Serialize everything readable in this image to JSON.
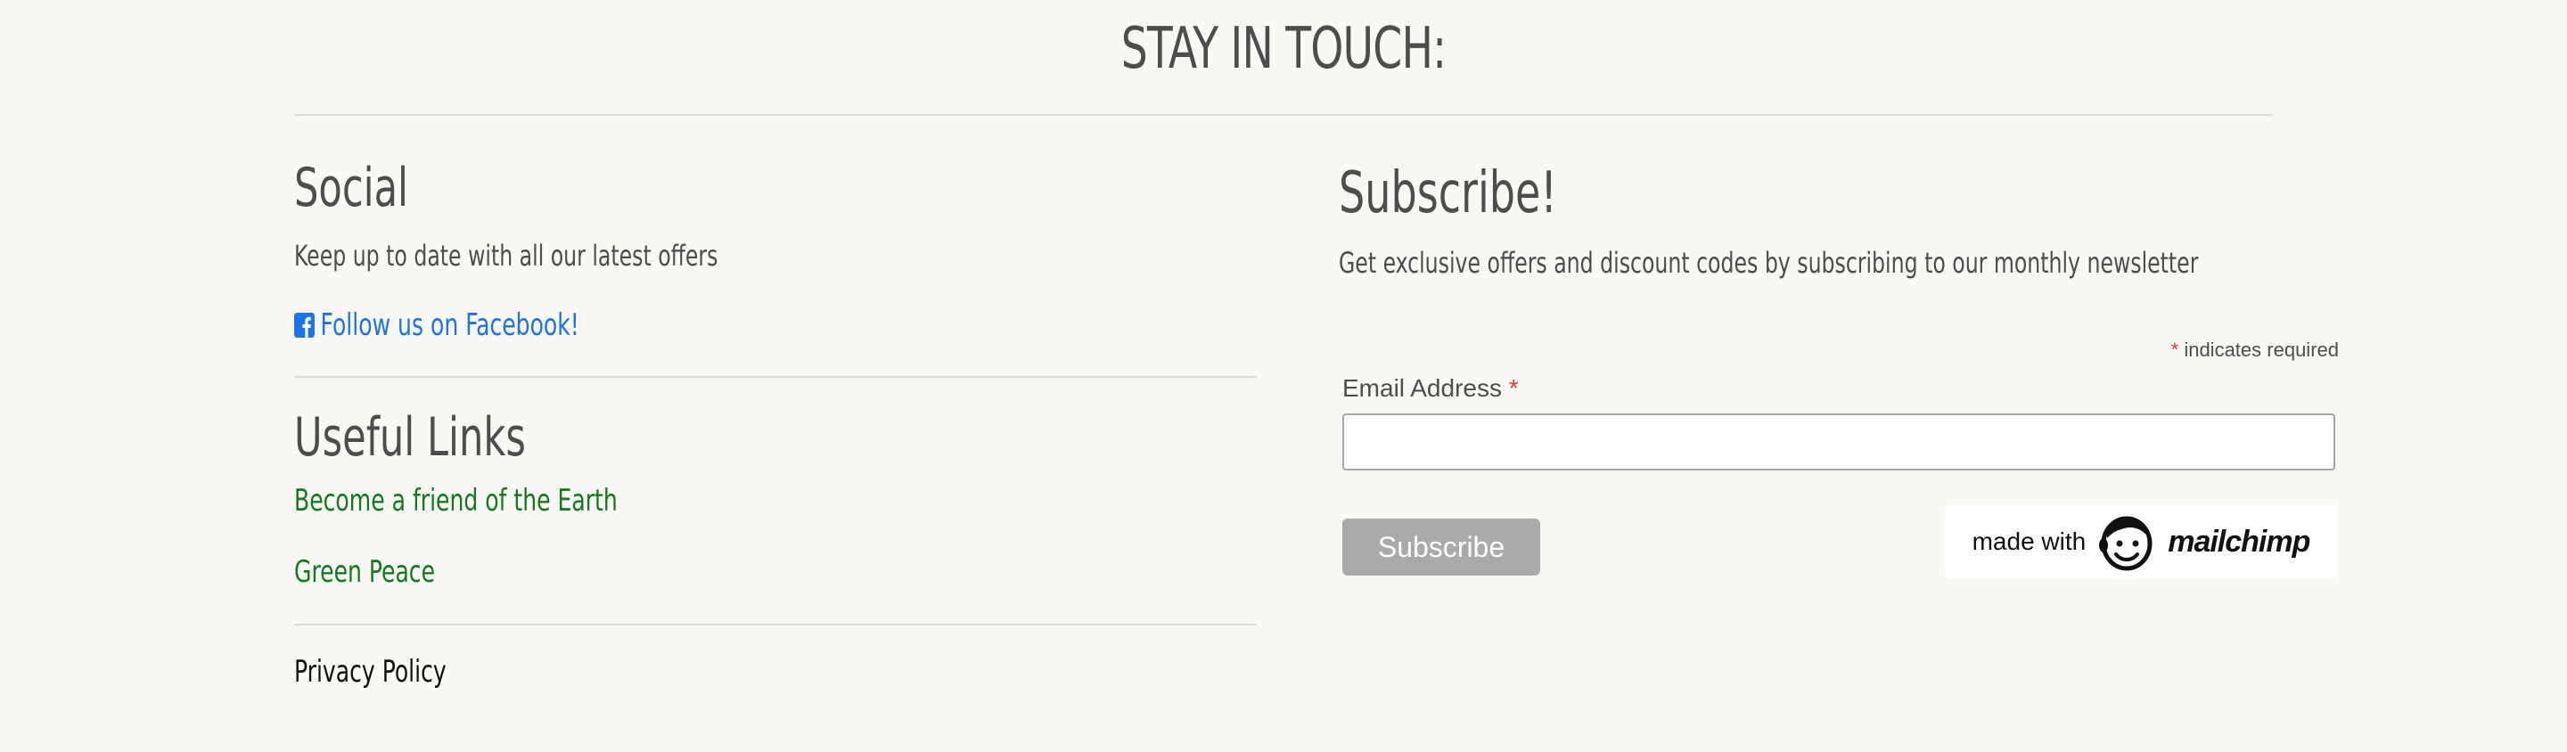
{
  "header": {
    "title": "STAY IN TOUCH:"
  },
  "social": {
    "heading": "Social",
    "text": "Keep up to date with all our latest offers",
    "facebook_link": "Follow us on Facebook!",
    "facebook_icon": "facebook-icon"
  },
  "useful_links": {
    "heading": "Useful Links",
    "links": [
      "Become a friend of the Earth",
      "Green Peace"
    ]
  },
  "privacy": {
    "label": "Privacy Policy"
  },
  "subscribe": {
    "heading": "Subscribe!",
    "text": "Get exclusive offers and discount codes by subscribing to our monthly newsletter",
    "required_note": "indicates required",
    "required_star": "*",
    "email_label": "Email Address",
    "email_value": "",
    "button_label": "Subscribe",
    "badge_made_with": "made with",
    "badge_brand": "mailchimp"
  },
  "colors": {
    "background": "#f9f8f5",
    "text": "#4d4d4d",
    "facebook_link": "#1a73e8",
    "green_link": "#117a1a",
    "required": "#d0413a",
    "button": "#aaaaaa"
  }
}
